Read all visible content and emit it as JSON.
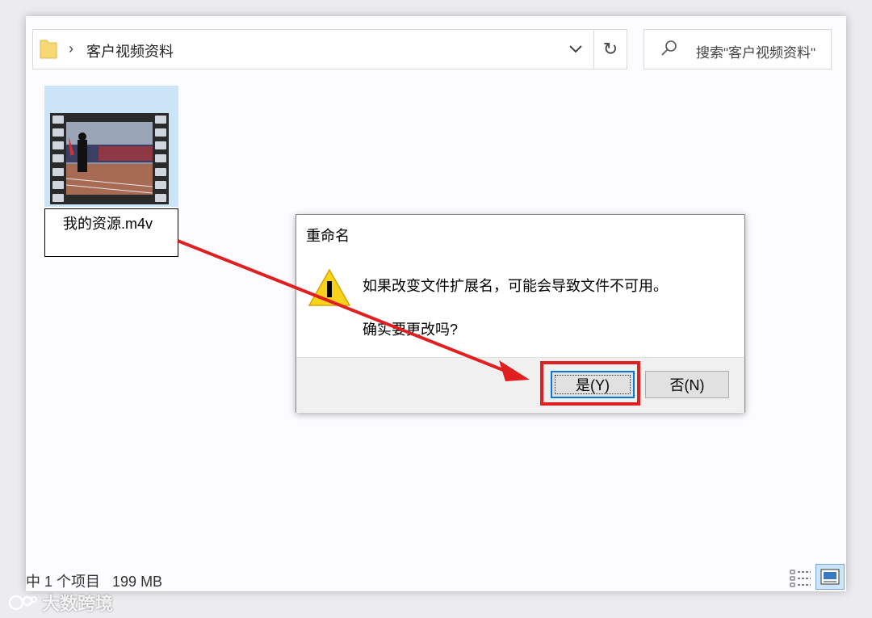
{
  "address_bar": {
    "path_label": "客户视频资料"
  },
  "search": {
    "placeholder": "搜索\"客户视频资料\""
  },
  "file": {
    "name": "我的资源.m4v"
  },
  "status_bar": {
    "item_count": "中 1 个项目",
    "size": "199 MB"
  },
  "dialog": {
    "title": "重命名",
    "message_line1": "如果改变文件扩展名，可能会导致文件不可用。",
    "message_line2": "确实要更改吗?",
    "yes_label": "是(Y)",
    "no_label": "否(N)"
  },
  "watermark": {
    "text": "大数跨境"
  },
  "colors": {
    "highlight": "#e02020",
    "selection": "#cce4f7",
    "focus": "#0078d7"
  }
}
